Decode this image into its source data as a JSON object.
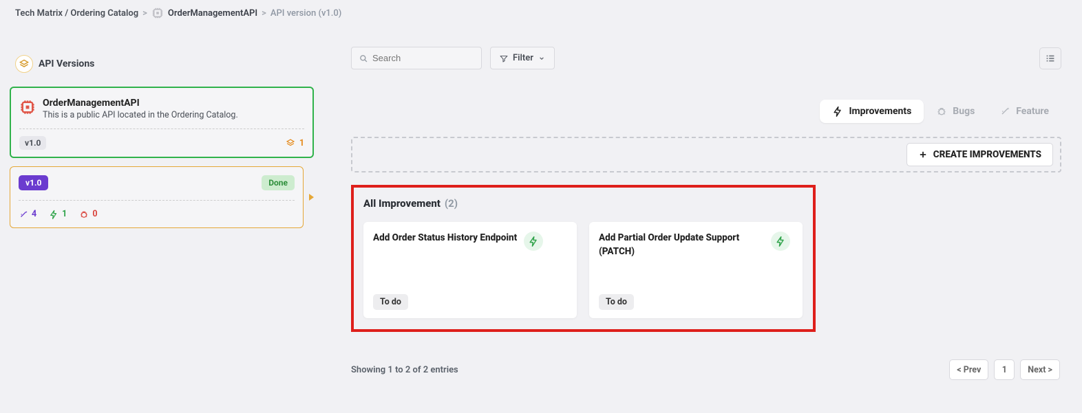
{
  "breadcrumb": {
    "path": "Tech Matrix / Ordering Catalog",
    "api_name": "OrderManagementAPI",
    "version_label": "API version (v1.0)"
  },
  "sidebar": {
    "section_title": "API Versions",
    "api": {
      "title": "OrderManagementAPI",
      "description": "This is a public API located in the Ordering Catalog.",
      "version_pill": "v1.0",
      "count": "1"
    },
    "version_card": {
      "version": "v1.0",
      "status": "Done",
      "stats": {
        "features": "4",
        "improvements": "1",
        "bugs": "0"
      }
    }
  },
  "toolbar": {
    "search_placeholder": "Search",
    "filter_label": "Filter"
  },
  "tabs": {
    "improvements": "Improvements",
    "bugs": "Bugs",
    "feature": "Feature"
  },
  "dropzone": {
    "create_label": "CREATE IMPROVEMENTS"
  },
  "list": {
    "title": "All Improvement",
    "count": "(2)",
    "items": [
      {
        "title": "Add Order Status History Endpoint",
        "status": "To do"
      },
      {
        "title": "Add Partial Order Update Support (PATCH)",
        "status": "To do"
      }
    ]
  },
  "footer": {
    "showing": "Showing 1 to 2 of 2 entries",
    "prev": "< Prev",
    "page": "1",
    "next": "Next >"
  }
}
